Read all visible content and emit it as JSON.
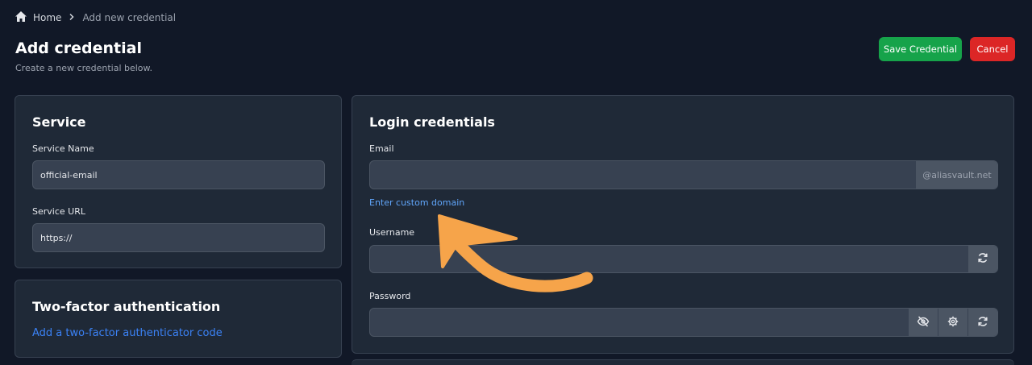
{
  "breadcrumb": {
    "home_label": "Home",
    "current_label": "Add new credential"
  },
  "header": {
    "title": "Add credential",
    "subtitle": "Create a new credential below.",
    "save_label": "Save Credential",
    "cancel_label": "Cancel"
  },
  "service": {
    "title": "Service",
    "name_label": "Service Name",
    "name_value": "official-email",
    "url_label": "Service URL",
    "url_value": "https://"
  },
  "two_factor": {
    "title": "Two-factor authentication",
    "add_link": "Add a two-factor authenticator code"
  },
  "login": {
    "title": "Login credentials",
    "email_label": "Email",
    "email_value": "",
    "email_domain": "@aliasvault.net",
    "custom_domain_link": "Enter custom domain",
    "username_label": "Username",
    "username_value": "",
    "password_label": "Password",
    "password_value": ""
  },
  "colors": {
    "background": "#111827",
    "card": "#1f2937",
    "input": "#374151",
    "save": "#16a34a",
    "cancel": "#dc2626",
    "link": "#60a5fa",
    "arrow": "#f6a44a"
  },
  "icons": [
    "home-icon",
    "chevron-right-icon",
    "refresh-icon",
    "eye-off-icon",
    "settings-icon",
    "arrow-annotation-icon"
  ]
}
